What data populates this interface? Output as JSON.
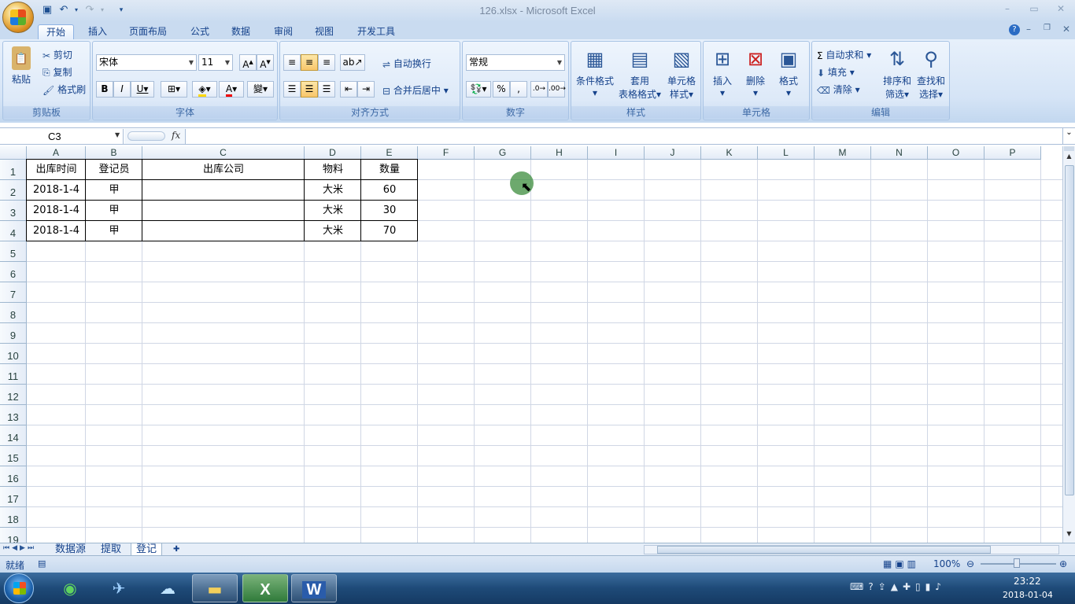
{
  "window": {
    "title": "126.xlsx - Microsoft Excel"
  },
  "qat": [
    "save-icon",
    "undo-icon",
    "redo-icon"
  ],
  "tabs": [
    "开始",
    "插入",
    "页面布局",
    "公式",
    "数据",
    "审阅",
    "视图",
    "开发工具"
  ],
  "ribbon": {
    "clipboard": {
      "label": "剪贴板",
      "paste": "粘贴",
      "cut": "剪切",
      "copy": "复制",
      "format_painter": "格式刷"
    },
    "font": {
      "label": "字体",
      "font_name": "宋体",
      "font_size": "11"
    },
    "alignment": {
      "label": "对齐方式",
      "wrap": "自动换行",
      "merge": "合并后居中"
    },
    "number": {
      "label": "数字",
      "format": "常规"
    },
    "styles": {
      "label": "样式",
      "conditional": "条件格式",
      "table1": "套用",
      "table2": "表格格式",
      "cell1": "单元格",
      "cell2": "样式"
    },
    "cells": {
      "label": "单元格",
      "insert": "插入",
      "delete": "删除",
      "format": "格式"
    },
    "editing": {
      "label": "编辑",
      "autosum": "自动求和",
      "fill": "填充",
      "clear": "清除",
      "sort1": "排序和",
      "sort2": "筛选",
      "find1": "查找和",
      "find2": "选择"
    }
  },
  "formula_bar": {
    "name_box": "C3",
    "fx": "fx",
    "value": ""
  },
  "columns": [
    "A",
    "B",
    "C",
    "D",
    "E",
    "F",
    "G",
    "H",
    "I",
    "J",
    "K",
    "L",
    "M",
    "N",
    "O",
    "P"
  ],
  "rows": [
    "1",
    "2",
    "3",
    "4",
    "5",
    "6",
    "7",
    "8",
    "9",
    "10",
    "11",
    "12",
    "13",
    "14",
    "15",
    "16",
    "17",
    "18",
    "19"
  ],
  "table": {
    "headers": [
      "出库时间",
      "登记员",
      "出库公司",
      "物料",
      "数量"
    ],
    "rows": [
      [
        "2018-1-4",
        "甲",
        "",
        "大米",
        "60"
      ],
      [
        "2018-1-4",
        "甲",
        "",
        "大米",
        "30"
      ],
      [
        "2018-1-4",
        "甲",
        "",
        "大米",
        "70"
      ]
    ]
  },
  "sheets": [
    "数据源",
    "提取",
    "登记"
  ],
  "active_sheet": "登记",
  "status": {
    "ready": "就绪",
    "zoom": "100%"
  },
  "taskbar": {
    "time": "23:22",
    "date": "2018-01-04"
  }
}
